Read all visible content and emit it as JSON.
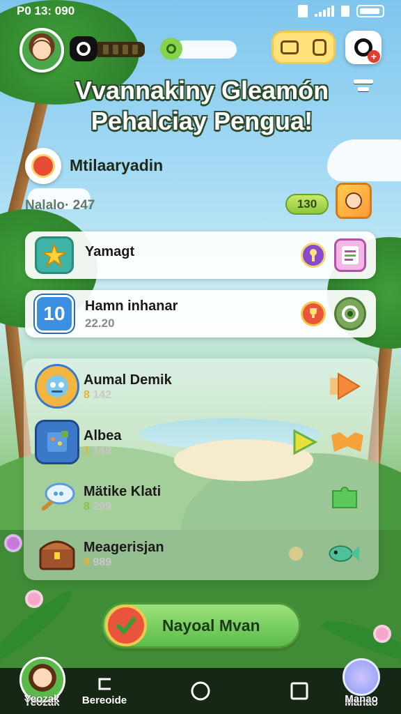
{
  "status_bar": {
    "time": "P0 13: 090"
  },
  "header": {
    "avatar_icon": "player-avatar",
    "camera_icon": "camera-icon",
    "coins_icon": "wallet-icon",
    "profile_icon": "profile-icon",
    "profile_badge": "+"
  },
  "title": {
    "line1": "Vvannakiny Gleamón",
    "line2": "Pehalciay Pengua!"
  },
  "section": {
    "title": "Mtilaaryadin",
    "sub_label": "Nalalo· 247",
    "count": "130"
  },
  "cards": [
    {
      "label": "Yamagt",
      "value": "",
      "icon_text": "",
      "icon": "star-icon"
    },
    {
      "label": "Hamn inhanar",
      "value": "22.20",
      "icon_text": "10",
      "icon": "level-icon"
    }
  ],
  "list": [
    {
      "name": "Aumal Demik",
      "num_prefix": "8",
      "num": "142",
      "icon": "robot-icon",
      "action_icon": "play-arrow-icon"
    },
    {
      "name": "Albea",
      "num_prefix": "1",
      "num": "149",
      "icon": "book-icon",
      "action_icon": "arrow-right-icon"
    },
    {
      "name": "Mätike Klati",
      "num_prefix": "8",
      "num": "299",
      "icon": "magnifier-icon",
      "action_icon": "puzzle-icon"
    },
    {
      "name": "Meagerisjan",
      "num_prefix": "8",
      "num": "989",
      "icon": "treasure-chest-icon",
      "action_icon": "fish-icon"
    }
  ],
  "cta": {
    "label": "Nayoal Mvan"
  },
  "bottom_nav": {
    "items": [
      {
        "label": "Yeozak"
      },
      {
        "label": "Bereoide"
      },
      {
        "label": ""
      },
      {
        "label": ""
      },
      {
        "label": "Manao"
      }
    ]
  },
  "colors": {
    "accent_green": "#5cbc4a",
    "badge_red": "#e43b2c",
    "pill_yellow": "#ffe27a"
  }
}
